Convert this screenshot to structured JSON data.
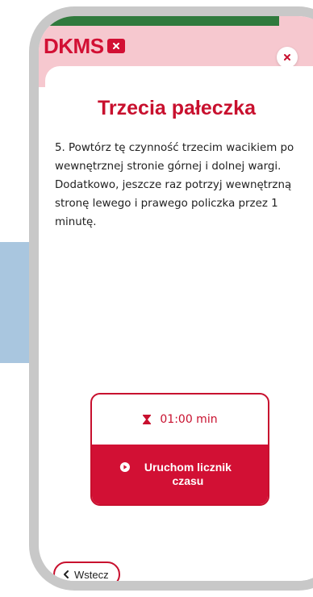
{
  "brand": {
    "logo_text": "DKMS",
    "logo_badge_icon": "x-icon",
    "accent_color": "#d21034",
    "header_bg": "#f6c8cf",
    "green_accent": "#2f7a3d"
  },
  "modal": {
    "close_icon": "close-icon",
    "title": "Trzecia pałeczka",
    "instruction": "5. Powtórz tę czynność trzecim wacikiem po wewnętrznej stronie górnej i dolnej wargi. Dodatkowo, jeszcze raz potrzyj wewnętrzną stronę lewego i prawego policzka przez 1 minutę."
  },
  "timer": {
    "icon": "hourglass-icon",
    "value": "01:00 min",
    "start_label": "Uruchom licznik czasu",
    "start_icon": "play-circle-icon"
  },
  "navigation": {
    "back_label": "Wstecz",
    "back_icon": "chevron-left-icon"
  }
}
